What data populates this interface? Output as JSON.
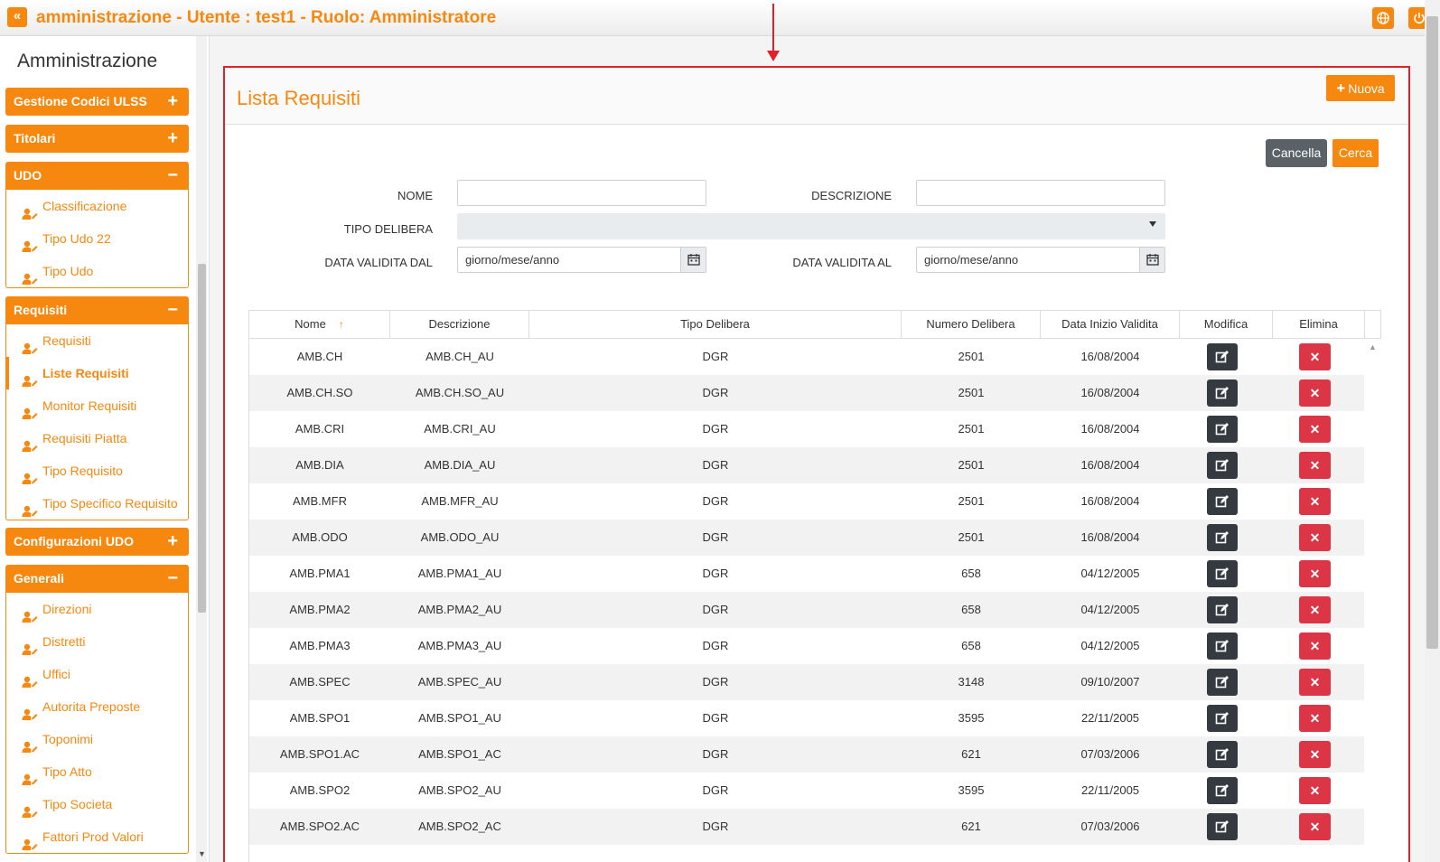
{
  "header": {
    "title": "amministrazione - Utente : test1 - Ruolo: Amministratore",
    "back_glyph": "«",
    "icons": [
      "globe-icon",
      "power-icon"
    ]
  },
  "sidebar": {
    "title": "Amministrazione",
    "groups": [
      {
        "label": "Gestione Codici ULSS",
        "sign": "+",
        "items": []
      },
      {
        "label": "Titolari",
        "sign": "+",
        "items": []
      },
      {
        "label": "UDO",
        "sign": "−",
        "items": [
          "Classificazione",
          "Tipo Udo 22",
          "Tipo Udo"
        ]
      },
      {
        "label": "Requisiti",
        "sign": "−",
        "items": [
          "Requisiti",
          "Liste Requisiti",
          "Monitor Requisiti",
          "Requisiti Piatta",
          "Tipo Requisito",
          "Tipo Specifico Requisito"
        ]
      },
      {
        "label": "Configurazioni UDO",
        "sign": "+",
        "items": []
      },
      {
        "label": "Generali",
        "sign": "−",
        "items": [
          "Direzioni",
          "Distretti",
          "Uffici",
          "Autorita Preposte",
          "Toponimi",
          "Tipo Atto",
          "Tipo Societa",
          "Fattori Prod Valori"
        ]
      }
    ],
    "active_item": "Liste Requisiti"
  },
  "main": {
    "title": "Lista Requisiti",
    "new_button": "Nuova",
    "cancel_button": "Cancella",
    "search_button": "Cerca",
    "filters": {
      "nome_label": "NOME",
      "nome_value": "",
      "descrizione_label": "DESCRIZIONE",
      "descrizione_value": "",
      "tipo_delibera_label": "TIPO DELIBERA",
      "tipo_delibera_value": "",
      "data_dal_label": "DATA VALIDITA DAL",
      "data_dal_placeholder": "giorno/mese/anno",
      "data_al_label": "DATA VALIDITA AL",
      "data_al_placeholder": "giorno/mese/anno"
    },
    "table": {
      "columns": [
        "Nome",
        "Descrizione",
        "Tipo Delibera",
        "Numero Delibera",
        "Data Inizio Validita",
        "Modifica",
        "Elimina"
      ],
      "sort_indicator": "↑",
      "delete_glyph": "✕",
      "rows": [
        [
          "AMB.CH",
          "AMB.CH_AU",
          "DGR",
          "2501",
          "16/08/2004"
        ],
        [
          "AMB.CH.SO",
          "AMB.CH.SO_AU",
          "DGR",
          "2501",
          "16/08/2004"
        ],
        [
          "AMB.CRI",
          "AMB.CRI_AU",
          "DGR",
          "2501",
          "16/08/2004"
        ],
        [
          "AMB.DIA",
          "AMB.DIA_AU",
          "DGR",
          "2501",
          "16/08/2004"
        ],
        [
          "AMB.MFR",
          "AMB.MFR_AU",
          "DGR",
          "2501",
          "16/08/2004"
        ],
        [
          "AMB.ODO",
          "AMB.ODO_AU",
          "DGR",
          "2501",
          "16/08/2004"
        ],
        [
          "AMB.PMA1",
          "AMB.PMA1_AU",
          "DGR",
          "658",
          "04/12/2005"
        ],
        [
          "AMB.PMA2",
          "AMB.PMA2_AU",
          "DGR",
          "658",
          "04/12/2005"
        ],
        [
          "AMB.PMA3",
          "AMB.PMA3_AU",
          "DGR",
          "658",
          "04/12/2005"
        ],
        [
          "AMB.SPEC",
          "AMB.SPEC_AU",
          "DGR",
          "3148",
          "09/10/2007"
        ],
        [
          "AMB.SPO1",
          "AMB.SPO1_AU",
          "DGR",
          "3595",
          "22/11/2005"
        ],
        [
          "AMB.SPO1.AC",
          "AMB.SPO1_AC",
          "DGR",
          "621",
          "07/03/2006"
        ],
        [
          "AMB.SPO2",
          "AMB.SPO2_AU",
          "DGR",
          "3595",
          "22/11/2005"
        ],
        [
          "AMB.SPO2.AC",
          "AMB.SPO2_AC",
          "DGR",
          "621",
          "07/03/2006"
        ]
      ]
    }
  },
  "colors": {
    "accent": "#f7880f",
    "danger": "#dc3545",
    "dark": "#343a40",
    "highlight_frame": "#e02127"
  }
}
